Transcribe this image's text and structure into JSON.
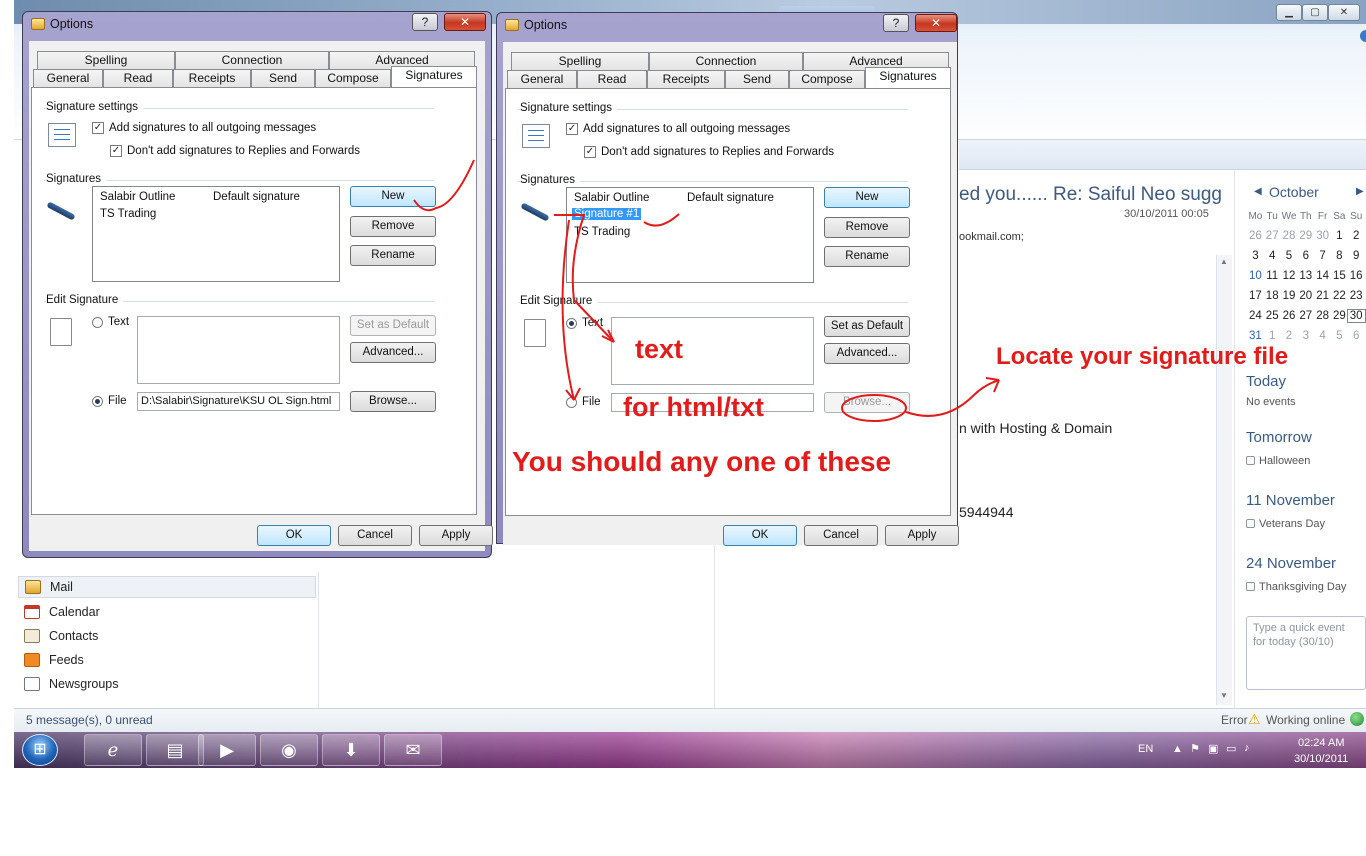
{
  "mail": {
    "subject": "ed you...... Re: Saiful Neo sugg",
    "date": "30/10/2011 00:05",
    "to_fragment": "ookmail.com;",
    "body_line1": "n with Hosting & Domain",
    "body_line2": "5944944",
    "status_left": "5 message(s), 0 unread",
    "status_error": "Error",
    "status_online": "Working online"
  },
  "nav": {
    "items": [
      {
        "label": "Mail",
        "icon": "mail-icon"
      },
      {
        "label": "Calendar",
        "icon": "calendar-icon"
      },
      {
        "label": "Contacts",
        "icon": "contacts-icon"
      },
      {
        "label": "Feeds",
        "icon": "feeds-icon"
      },
      {
        "label": "Newsgroups",
        "icon": "newsgroups-icon"
      }
    ]
  },
  "calendar": {
    "month": "October",
    "weekdays": [
      "Mo",
      "Tu",
      "We",
      "Th",
      "Fr",
      "Sa",
      "Su"
    ],
    "weeks": [
      [
        "26",
        "27",
        "28",
        "29",
        "30",
        "1",
        "2"
      ],
      [
        "3",
        "4",
        "5",
        "6",
        "7",
        "8",
        "9"
      ],
      [
        "10",
        "11",
        "12",
        "13",
        "14",
        "15",
        "16"
      ],
      [
        "17",
        "18",
        "19",
        "20",
        "21",
        "22",
        "23"
      ],
      [
        "24",
        "25",
        "26",
        "27",
        "28",
        "29",
        "30"
      ],
      [
        "31",
        "1",
        "2",
        "3",
        "4",
        "5",
        "6"
      ]
    ],
    "today_heading": "Today",
    "today_text": "No events",
    "tomorrow_heading": "Tomorrow",
    "tomorrow_event": "Halloween",
    "nov11_heading": "11 November",
    "nov11_event": "Veterans Day",
    "nov24_heading": "24 November",
    "nov24_event": "Thanksgiving Day",
    "quick_event_placeholder": "Type a quick event for today (30/10)"
  },
  "dialog1": {
    "title": "Options",
    "tabs_row1": [
      "Spelling",
      "Connection",
      "Advanced"
    ],
    "tabs_row2": [
      "General",
      "Read",
      "Receipts",
      "Send",
      "Compose",
      "Signatures"
    ],
    "sig_settings_label": "Signature settings",
    "cb_add_all": "Add signatures to all outgoing messages",
    "cb_no_replies": "Don't add signatures to Replies and Forwards",
    "signatures_label": "Signatures",
    "list": [
      {
        "name": "Salabir Outline",
        "note": "Default signature"
      },
      {
        "name": "TS Trading",
        "note": ""
      }
    ],
    "btn_new": "New",
    "btn_remove": "Remove",
    "btn_rename": "Rename",
    "edit_sig_label": "Edit Signature",
    "radio_text": "Text",
    "radio_file": "File",
    "btn_set_default": "Set as Default",
    "btn_advanced": "Advanced...",
    "file_path": "D:\\Salabir\\Signature\\KSU OL Sign.html",
    "btn_browse": "Browse...",
    "btn_ok": "OK",
    "btn_cancel": "Cancel",
    "btn_apply": "Apply"
  },
  "dialog2": {
    "title": "Options",
    "tabs_row1": [
      "Spelling",
      "Connection",
      "Advanced"
    ],
    "tabs_row2": [
      "General",
      "Read",
      "Receipts",
      "Send",
      "Compose",
      "Signatures"
    ],
    "sig_settings_label": "Signature settings",
    "cb_add_all": "Add signatures to all outgoing messages",
    "cb_no_replies": "Don't add signatures to Replies and Forwards",
    "signatures_label": "Signatures",
    "list": [
      {
        "name": "Salabir Outline",
        "note": "Default signature"
      },
      {
        "name": "Signature #1",
        "note": ""
      },
      {
        "name": "TS Trading",
        "note": ""
      }
    ],
    "btn_new": "New",
    "btn_remove": "Remove",
    "btn_rename": "Rename",
    "edit_sig_label": "Edit Signature",
    "radio_text": "Text",
    "radio_file": "File",
    "btn_set_default": "Set as Default",
    "btn_advanced": "Advanced...",
    "btn_browse": "Browse...",
    "btn_ok": "OK",
    "btn_cancel": "Cancel",
    "btn_apply": "Apply"
  },
  "annotations": {
    "text": "text",
    "html_txt": "for html/txt",
    "any_one": "You should any one of these",
    "locate": "Locate your signature file"
  },
  "tray": {
    "lang": "EN",
    "time": "02:24 AM",
    "date": "30/10/2011"
  },
  "colors": {
    "annotation": "#e21b1b",
    "selection": "#3399ff",
    "accent": "#3a5a86"
  }
}
